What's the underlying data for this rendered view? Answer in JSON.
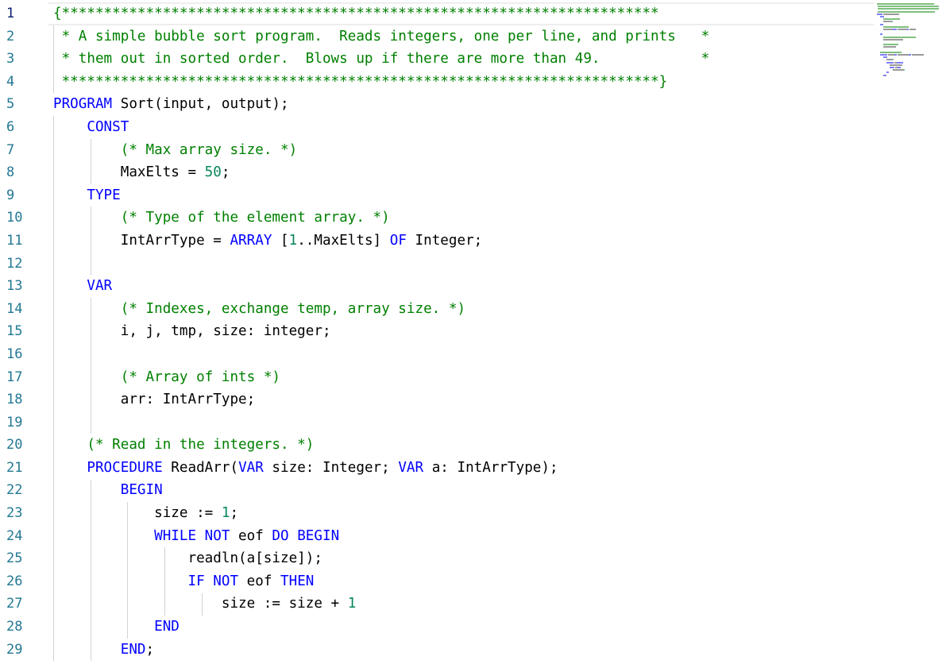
{
  "editor": {
    "language": "Pascal",
    "active_line": 1,
    "colors": {
      "comment": "#008000",
      "keyword": "#0000ff",
      "number": "#098658",
      "text": "#000000",
      "line_number": "#237893",
      "active_line_number": "#0b216f"
    },
    "lines": [
      {
        "n": "1",
        "tokens": [
          {
            "t": "cm",
            "v": "{***********************************************************************"
          }
        ]
      },
      {
        "n": "2",
        "tokens": [
          {
            "t": "cm",
            "v": " * A simple bubble sort program.  Reads integers, one per line, and prints   *"
          }
        ]
      },
      {
        "n": "3",
        "tokens": [
          {
            "t": "cm",
            "v": " * them out in sorted order.  Blows up if there are more than 49.            *"
          }
        ]
      },
      {
        "n": "4",
        "tokens": [
          {
            "t": "cm",
            "v": " ***********************************************************************}"
          }
        ]
      },
      {
        "n": "5",
        "tokens": [
          {
            "t": "kw",
            "v": "PROGRAM"
          },
          {
            "t": "tx",
            "v": " Sort(input, output);"
          }
        ]
      },
      {
        "n": "6",
        "tokens": [
          {
            "t": "tx",
            "v": "    "
          },
          {
            "t": "kw",
            "v": "CONST"
          }
        ]
      },
      {
        "n": "7",
        "tokens": [
          {
            "t": "tx",
            "v": "        "
          },
          {
            "t": "cm",
            "v": "(* Max array size. *)"
          }
        ]
      },
      {
        "n": "8",
        "tokens": [
          {
            "t": "tx",
            "v": "        MaxElts = "
          },
          {
            "t": "nu",
            "v": "50"
          },
          {
            "t": "tx",
            "v": ";"
          }
        ]
      },
      {
        "n": "9",
        "tokens": [
          {
            "t": "tx",
            "v": "    "
          },
          {
            "t": "kw",
            "v": "TYPE"
          }
        ]
      },
      {
        "n": "10",
        "tokens": [
          {
            "t": "tx",
            "v": "        "
          },
          {
            "t": "cm",
            "v": "(* Type of the element array. *)"
          }
        ]
      },
      {
        "n": "11",
        "tokens": [
          {
            "t": "tx",
            "v": "        IntArrType = "
          },
          {
            "t": "kw",
            "v": "ARRAY"
          },
          {
            "t": "tx",
            "v": " ["
          },
          {
            "t": "nu",
            "v": "1"
          },
          {
            "t": "tx",
            "v": "..MaxElts] "
          },
          {
            "t": "kw",
            "v": "OF"
          },
          {
            "t": "tx",
            "v": " Integer;"
          }
        ]
      },
      {
        "n": "12",
        "tokens": []
      },
      {
        "n": "13",
        "tokens": [
          {
            "t": "tx",
            "v": "    "
          },
          {
            "t": "kw",
            "v": "VAR"
          }
        ]
      },
      {
        "n": "14",
        "tokens": [
          {
            "t": "tx",
            "v": "        "
          },
          {
            "t": "cm",
            "v": "(* Indexes, exchange temp, array size. *)"
          }
        ]
      },
      {
        "n": "15",
        "tokens": [
          {
            "t": "tx",
            "v": "        i, j, tmp, size: integer;"
          }
        ]
      },
      {
        "n": "16",
        "tokens": []
      },
      {
        "n": "17",
        "tokens": [
          {
            "t": "tx",
            "v": "        "
          },
          {
            "t": "cm",
            "v": "(* Array of ints *)"
          }
        ]
      },
      {
        "n": "18",
        "tokens": [
          {
            "t": "tx",
            "v": "        arr: IntArrType;"
          }
        ]
      },
      {
        "n": "19",
        "tokens": []
      },
      {
        "n": "20",
        "tokens": [
          {
            "t": "tx",
            "v": "    "
          },
          {
            "t": "cm",
            "v": "(* Read in the integers. *)"
          }
        ]
      },
      {
        "n": "21",
        "tokens": [
          {
            "t": "tx",
            "v": "    "
          },
          {
            "t": "kw",
            "v": "PROCEDURE"
          },
          {
            "t": "tx",
            "v": " ReadArr("
          },
          {
            "t": "kw",
            "v": "VAR"
          },
          {
            "t": "tx",
            "v": " size: Integer; "
          },
          {
            "t": "kw",
            "v": "VAR"
          },
          {
            "t": "tx",
            "v": " a: IntArrType);"
          }
        ]
      },
      {
        "n": "22",
        "tokens": [
          {
            "t": "tx",
            "v": "        "
          },
          {
            "t": "kw",
            "v": "BEGIN"
          }
        ]
      },
      {
        "n": "23",
        "tokens": [
          {
            "t": "tx",
            "v": "            size := "
          },
          {
            "t": "nu",
            "v": "1"
          },
          {
            "t": "tx",
            "v": ";"
          }
        ]
      },
      {
        "n": "24",
        "tokens": [
          {
            "t": "tx",
            "v": "            "
          },
          {
            "t": "kw",
            "v": "WHILE NOT"
          },
          {
            "t": "tx",
            "v": " eof "
          },
          {
            "t": "kw",
            "v": "DO BEGIN"
          }
        ]
      },
      {
        "n": "25",
        "tokens": [
          {
            "t": "tx",
            "v": "                readln(a[size]);"
          }
        ]
      },
      {
        "n": "26",
        "tokens": [
          {
            "t": "tx",
            "v": "                "
          },
          {
            "t": "kw",
            "v": "IF NOT"
          },
          {
            "t": "tx",
            "v": " eof "
          },
          {
            "t": "kw",
            "v": "THEN"
          }
        ]
      },
      {
        "n": "27",
        "tokens": [
          {
            "t": "tx",
            "v": "                    size := size + "
          },
          {
            "t": "nu",
            "v": "1"
          }
        ]
      },
      {
        "n": "28",
        "tokens": [
          {
            "t": "tx",
            "v": "            "
          },
          {
            "t": "kw",
            "v": "END"
          }
        ]
      },
      {
        "n": "29",
        "tokens": [
          {
            "t": "tx",
            "v": "        "
          },
          {
            "t": "kw",
            "v": "END"
          },
          {
            "t": "tx",
            "v": ";"
          }
        ]
      }
    ]
  }
}
